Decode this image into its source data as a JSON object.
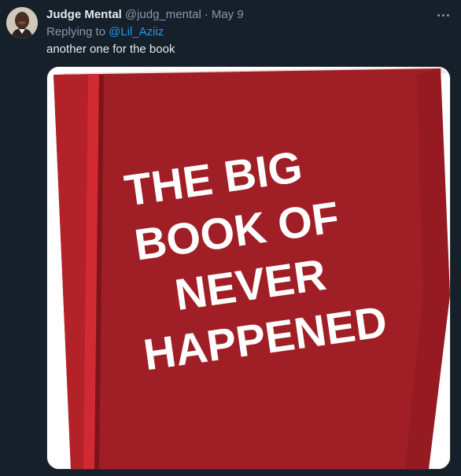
{
  "tweet": {
    "author_name": "Judge Mental",
    "author_handle": "@judg_mental",
    "separator": "·",
    "date": "May 9",
    "reply_prefix": "Replying to",
    "reply_to": "@Lil_Aziiz",
    "text": "another one for the book"
  },
  "media": {
    "book_lines": [
      "THE BIG",
      "BOOK OF",
      "NEVER",
      "HAPPENED"
    ]
  },
  "icons": {
    "more": "more-options-icon",
    "avatar": "avatar"
  },
  "colors": {
    "background": "#15202b",
    "primary_text": "#e7e9ea",
    "secondary_text": "#8b98a5",
    "link": "#1d9bf0",
    "book_red": "#a01e25"
  }
}
